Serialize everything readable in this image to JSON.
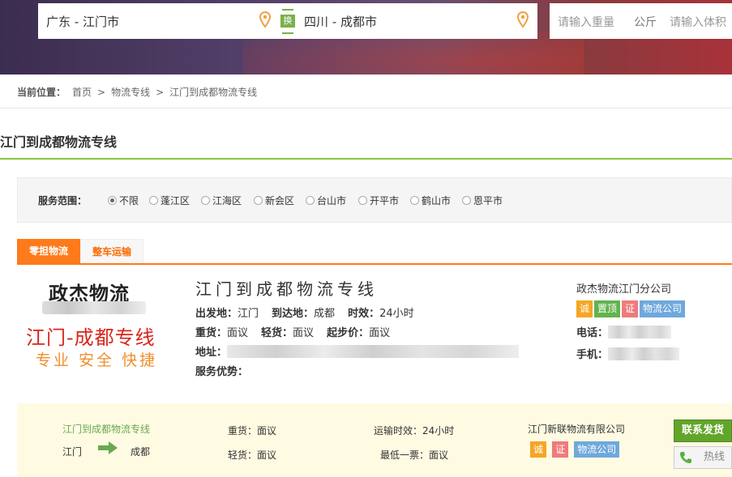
{
  "search": {
    "from_value": "广东 - 江门市",
    "swap_label": "换",
    "to_value": "四川 - 成都市",
    "weight_placeholder": "请输入重量",
    "weight_unit": "公斤",
    "volume_placeholder": "请输入体积"
  },
  "breadcrumb": {
    "label": "当前位置：",
    "items": [
      "首页",
      "物流专线",
      "江门到成都物流专线"
    ],
    "separator": ">"
  },
  "page_title": "江门到成都物流专线",
  "filter": {
    "label": "服务范围：",
    "options": [
      "不限",
      "蓬江区",
      "江海区",
      "新会区",
      "台山市",
      "开平市",
      "鹤山市",
      "恩平市"
    ],
    "selected": "不限"
  },
  "tabs": [
    "零担物流",
    "整车运输"
  ],
  "listing": {
    "logo": {
      "name": "政杰物流",
      "route": "江门-成都专线",
      "slogan": "专业 安全 快捷"
    },
    "title": "江门到成都物流专线",
    "depart_label": "出发地：",
    "depart_value": "江门",
    "arrive_label": "到达地：",
    "arrive_value": "成都",
    "time_label": "时效：",
    "time_value": "24小时",
    "heavy_label": "重货：",
    "heavy_value": "面议",
    "light_label": "轻货：",
    "light_value": "面议",
    "start_label": "起步价：",
    "start_value": "面议",
    "address_label": "地址：",
    "advantage_label": "服务优势：",
    "company": "政杰物流江门分公司",
    "badges": [
      "诚",
      "置顶",
      "证",
      "物流公司"
    ],
    "phone_label": "电话：",
    "mobile_label": "手机："
  },
  "listing2": {
    "route": "江门到成都物流专线",
    "from": "江门",
    "to": "成都",
    "heavy": "重货：面议",
    "light": "轻货：面议",
    "time": "运输时效：24小时",
    "min_ticket": "最低一票：面议",
    "company": "江门新联物流有限公司",
    "badges": [
      "诚",
      "证",
      "物流公司"
    ],
    "ship_button": "联系发货",
    "hotline_button": "热线"
  },
  "colors": {
    "accent_green": "#8cc63f",
    "tab_orange": "#ff7a1a",
    "logo_red": "#d8261c",
    "logo_orange": "#f08e2c"
  }
}
